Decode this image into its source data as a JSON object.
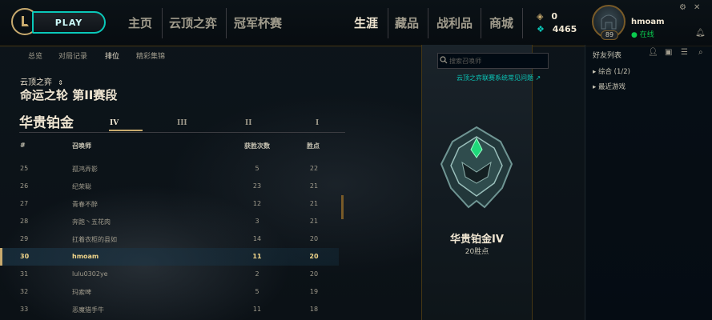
{
  "header": {
    "play_label": "PLAY",
    "nav": [
      {
        "label": "主页"
      },
      {
        "label": "云顶之弈"
      },
      {
        "label": "冠军杯赛"
      },
      {
        "label": "生涯"
      },
      {
        "label": "藏品"
      },
      {
        "label": "战利品"
      },
      {
        "label": "商城"
      }
    ],
    "active_nav": "生涯",
    "currency": {
      "rp": "0",
      "be": "4465"
    },
    "profile": {
      "name": "hmoam",
      "status": "在线",
      "level": "89"
    }
  },
  "subtabs": [
    "总览",
    "对局记录",
    "排位",
    "精彩集锦"
  ],
  "active_subtab": "排位",
  "ranked": {
    "mode": "云顶之弈",
    "season": "命运之轮 第II赛段",
    "tier": "华贵铂金",
    "divisions": [
      "IV",
      "III",
      "II",
      "I"
    ],
    "active_division": "IV",
    "columns": [
      "#",
      "召唤师",
      "获胜次数",
      "胜点"
    ],
    "rows": [
      {
        "rank": "25",
        "name": "孤鸿弄影",
        "wins": "5",
        "lp": "22"
      },
      {
        "rank": "26",
        "name": "纪荣聪",
        "wins": "23",
        "lp": "21"
      },
      {
        "rank": "27",
        "name": "青春不醉",
        "wins": "12",
        "lp": "21"
      },
      {
        "rank": "28",
        "name": "奔跑丶五花肉",
        "wins": "3",
        "lp": "21"
      },
      {
        "rank": "29",
        "name": "扛着衣柜的县如",
        "wins": "14",
        "lp": "20"
      },
      {
        "rank": "30",
        "name": "hmoam",
        "wins": "11",
        "lp": "20",
        "highlight": true
      },
      {
        "rank": "31",
        "name": "lulu0302ye",
        "wins": "2",
        "lp": "20"
      },
      {
        "rank": "32",
        "name": "玛索啤",
        "wins": "5",
        "lp": "19"
      },
      {
        "rank": "33",
        "name": "恶魔猎手牛",
        "wins": "11",
        "lp": "18"
      }
    ]
  },
  "banner": {
    "rank": "华贵铂金IV",
    "wins": "20胜点"
  },
  "search": {
    "placeholder": "搜索召唤师",
    "faq": "云顶之弈联赛系统常见问题 ↗"
  },
  "friends": {
    "title": "好友列表",
    "groups": [
      "▸ 综合 (1/2)",
      "▸ 最近游戏"
    ]
  },
  "colors": {
    "gold": "#c8aa6e",
    "teal": "#0ac8b9",
    "bg": "#0a1015"
  }
}
